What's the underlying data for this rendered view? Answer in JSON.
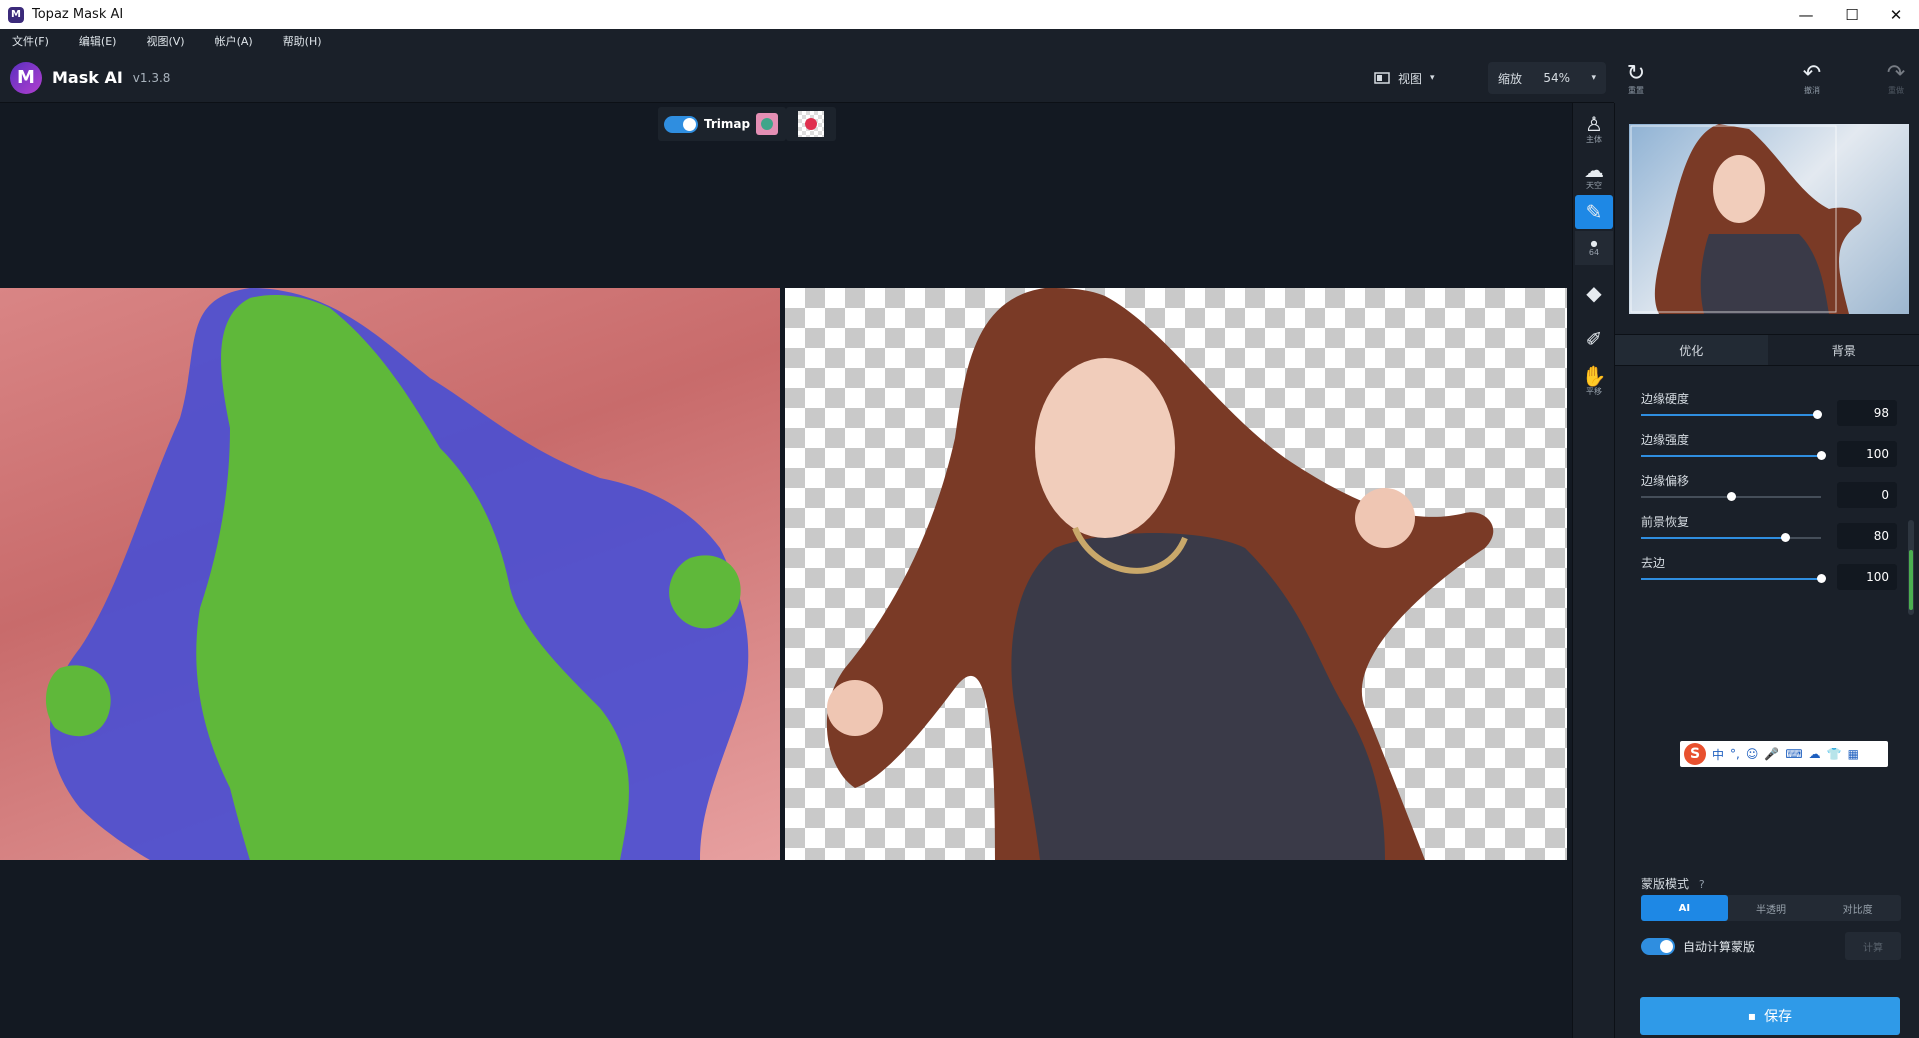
{
  "window": {
    "title": "Topaz Mask AI",
    "minimize": "—",
    "maximize": "☐",
    "close": "✕"
  },
  "menu": [
    "文件(F)",
    "编辑(E)",
    "视图(V)",
    "帐户(A)",
    "帮助(H)"
  ],
  "app": {
    "logo_letter": "M",
    "name": "Mask AI",
    "version": "v1.3.8"
  },
  "toolbar": {
    "view_label": "视图",
    "zoom_label": "缩放",
    "zoom_value": "54%"
  },
  "right_top": {
    "reset_label": "重置",
    "undo_label": "撤消",
    "redo_label": "重做"
  },
  "canvas": {
    "trimap_label": "Trimap",
    "trimap_enabled": true
  },
  "tools": [
    {
      "name": "subject-tool",
      "label": "主体",
      "icon": "person-icon"
    },
    {
      "name": "sky-tool",
      "label": "天空",
      "icon": "cloud-icon"
    },
    {
      "name": "brush-tool",
      "label": "",
      "icon": "brush-icon",
      "active": true
    },
    {
      "name": "brush-size",
      "label": "64",
      "icon": "dot-icon"
    },
    {
      "name": "fill-tool",
      "label": "",
      "icon": "bucket-icon"
    },
    {
      "name": "eyedropper-tool",
      "label": "",
      "icon": "eyedropper-icon"
    },
    {
      "name": "pan-tool",
      "label": "平移",
      "icon": "hand-icon"
    }
  ],
  "panel": {
    "tabs": [
      "优化",
      "背景"
    ],
    "active_tab": 0,
    "sliders": [
      {
        "label": "边缘硬度",
        "value": "98",
        "fraction": 0.98
      },
      {
        "label": "边缘强度",
        "value": "100",
        "fraction": 1.0
      },
      {
        "label": "边缘偏移",
        "value": "0",
        "fraction": 0.5
      },
      {
        "label": "前景恢复",
        "value": "80",
        "fraction": 0.8
      },
      {
        "label": "去边",
        "value": "100",
        "fraction": 1.0
      }
    ],
    "mask_mode": {
      "title": "蒙版模式",
      "options": [
        "AI",
        "半透明",
        "对比度"
      ],
      "selected": 0
    },
    "auto_compute_label": "自动计算蒙版",
    "auto_compute_enabled": true,
    "compute_label": "计算",
    "save_label": "保存"
  },
  "ime": {
    "logo": "S",
    "items": [
      "中",
      "°,",
      "☺",
      "🎤",
      "⌨",
      "☁",
      "👕",
      "▦"
    ]
  },
  "colors": {
    "accent": "#1e88e5",
    "trimap_foreground": "#5fb83a",
    "trimap_edge": "#4b4fd1",
    "trimap_background": "#d98585"
  }
}
